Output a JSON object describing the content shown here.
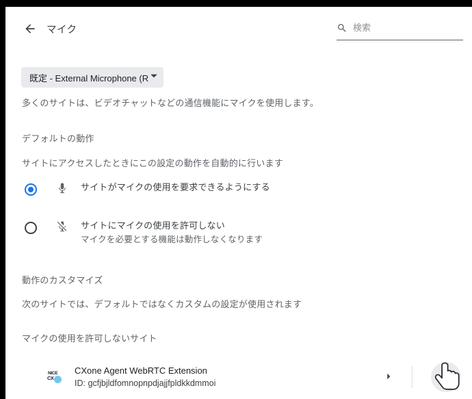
{
  "window": {
    "frame_color": "#000000",
    "page_background": "#ffffff"
  },
  "header": {
    "back_label": "back-arrow",
    "title": "マイク",
    "search": {
      "placeholder": "検索",
      "value": ""
    }
  },
  "device": {
    "selected": "既定 - External Microphone (R",
    "caret": "▼"
  },
  "description": "多くのサイトは、ビデオチャットなどの通信機能にマイクを使用します。",
  "default_behavior": {
    "title": "デフォルトの動作",
    "subtitle": "サイトにアクセスしたときにこの設定の動作を自動的に行います",
    "options": [
      {
        "id": "allow",
        "label": "サイトがマイクの使用を要求できるようにする",
        "sublabel": "",
        "selected": true,
        "icon": "mic-icon"
      },
      {
        "id": "block",
        "label": "サイトにマイクの使用を許可しない",
        "sublabel": "マイクを必要とする機能は動作しなくなります",
        "selected": false,
        "icon": "mic-off-icon"
      }
    ]
  },
  "customized": {
    "title": "動作のカスタマイズ",
    "subtitle": "次のサイトでは、デフォルトではなくカスタムの設定が使用されます"
  },
  "blocked_list": {
    "title": "マイクの使用を許可しないサイト",
    "items": [
      {
        "name": "CXone Agent WebRTC Extension",
        "id_text": "ID: gcfjbjldfomnopnpdjajjfpldkkdmmoi",
        "favicon": {
          "top_text": "NICE",
          "bottom_text": "CX",
          "accent_color": "#6fc9ee"
        },
        "chevron": "chevron-right-icon",
        "delete": "trash-icon"
      }
    ]
  },
  "colors": {
    "accent_blue": "#1a73e8",
    "text_primary": "#202124",
    "text_secondary": "#5f6368",
    "chip_background": "#e8eaed",
    "hover_circle": "#ebebeb"
  }
}
